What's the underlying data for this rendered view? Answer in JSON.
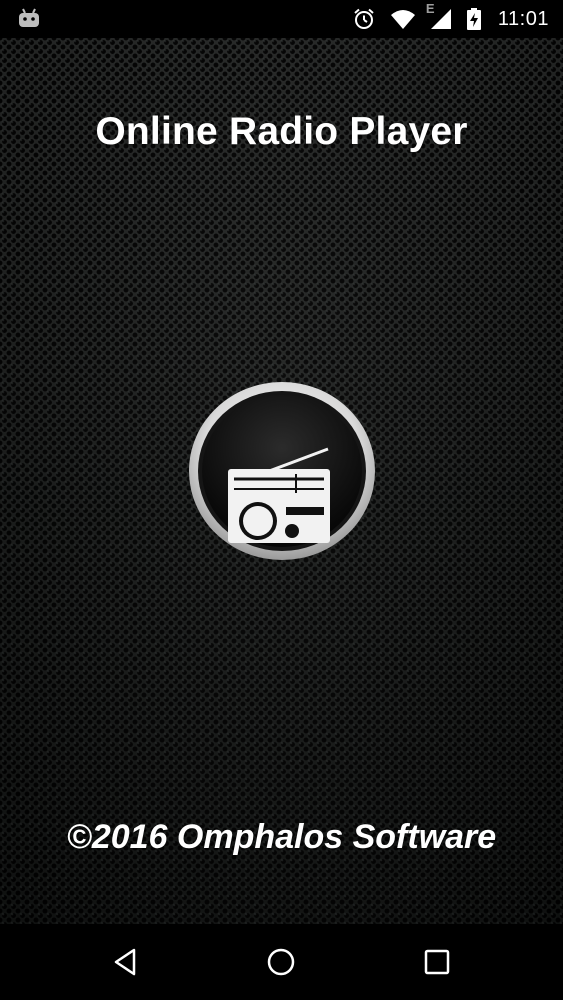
{
  "status_bar": {
    "time": "11:01",
    "network_type": "E",
    "icons": [
      "android-debug-icon",
      "alarm-icon",
      "wifi-icon",
      "signal-icon",
      "battery-charging-icon"
    ]
  },
  "splash": {
    "title": "Online Radio Player",
    "logo_icon": "radio-icon",
    "copyright": "©2016 Omphalos Software"
  },
  "nav_bar": {
    "buttons": [
      "back-icon",
      "home-icon",
      "recents-icon"
    ]
  },
  "colors": {
    "background_dark": "#1b1d1c",
    "text": "#ffffff",
    "logo_ring": "#e8e8e8"
  }
}
